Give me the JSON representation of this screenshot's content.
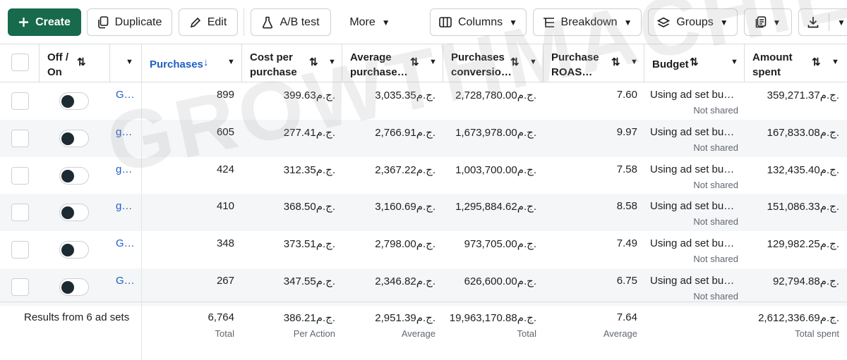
{
  "toolbar": {
    "create": "Create",
    "duplicate": "Duplicate",
    "edit": "Edit",
    "ab_test": "A/B test",
    "more": "More",
    "columns": "Columns",
    "breakdown": "Breakdown",
    "groups": "Groups"
  },
  "headers": {
    "off_on": "Off / On",
    "purchases": "Purchases",
    "cost_per_purchase": "Cost per purchase",
    "avg_purchase": "Average purchase…",
    "purchases_conversion": "Purchases conversio…",
    "purchase_roas": "Purchase ROAS…",
    "budget": "Budget",
    "amount_spent": "Amount spent"
  },
  "rows": [
    {
      "name": "G…",
      "purchases": "899",
      "cost": "399.63ج.م.",
      "avg": "3,035.35ج.م.",
      "conv": "2,728,780.00ج.م.",
      "roas": "7.60",
      "budget": "Using ad set bu…",
      "budget_sub": "Not shared",
      "spent": "359,271.37ج.م."
    },
    {
      "name": "g…",
      "purchases": "605",
      "cost": "277.41ج.م.",
      "avg": "2,766.91ج.م.",
      "conv": "1,673,978.00ج.م.",
      "roas": "9.97",
      "budget": "Using ad set bu…",
      "budget_sub": "Not shared",
      "spent": "167,833.08ج.م."
    },
    {
      "name": "g…",
      "purchases": "424",
      "cost": "312.35ج.م.",
      "avg": "2,367.22ج.م.",
      "conv": "1,003,700.00ج.م.",
      "roas": "7.58",
      "budget": "Using ad set bu…",
      "budget_sub": "Not shared",
      "spent": "132,435.40ج.م."
    },
    {
      "name": "g…",
      "purchases": "410",
      "cost": "368.50ج.م.",
      "avg": "3,160.69ج.م.",
      "conv": "1,295,884.62ج.م.",
      "roas": "8.58",
      "budget": "Using ad set bu…",
      "budget_sub": "Not shared",
      "spent": "151,086.33ج.م."
    },
    {
      "name": "G…",
      "purchases": "348",
      "cost": "373.51ج.م.",
      "avg": "2,798.00ج.م.",
      "conv": "973,705.00ج.م.",
      "roas": "7.49",
      "budget": "Using ad set bu…",
      "budget_sub": "Not shared",
      "spent": "129,982.25ج.م."
    },
    {
      "name": "G…",
      "purchases": "267",
      "cost": "347.55ج.م.",
      "avg": "2,346.82ج.م.",
      "conv": "626,600.00ج.م.",
      "roas": "6.75",
      "budget": "Using ad set bu…",
      "budget_sub": "Not shared",
      "spent": "92,794.88ج.م."
    }
  ],
  "summary": {
    "label": "Results from 6 ad sets",
    "purchases": "6,764",
    "purchases_sub": "Total",
    "cost": "386.21ج.م.",
    "cost_sub": "Per Action",
    "avg": "2,951.39ج.م.",
    "avg_sub": "Average",
    "conv": "19,963,170.88ج.م.",
    "conv_sub": "Total",
    "roas": "7.64",
    "roas_sub": "Average",
    "spent": "2,612,336.69ج.م.",
    "spent_sub": "Total spent"
  },
  "watermark": "GROWTHMACHIENS",
  "colors": {
    "create_bg": "#176a4c",
    "link": "#1d5fc7",
    "sorted_header": "#1d5fc7",
    "row_alt": "#f5f6f7"
  }
}
